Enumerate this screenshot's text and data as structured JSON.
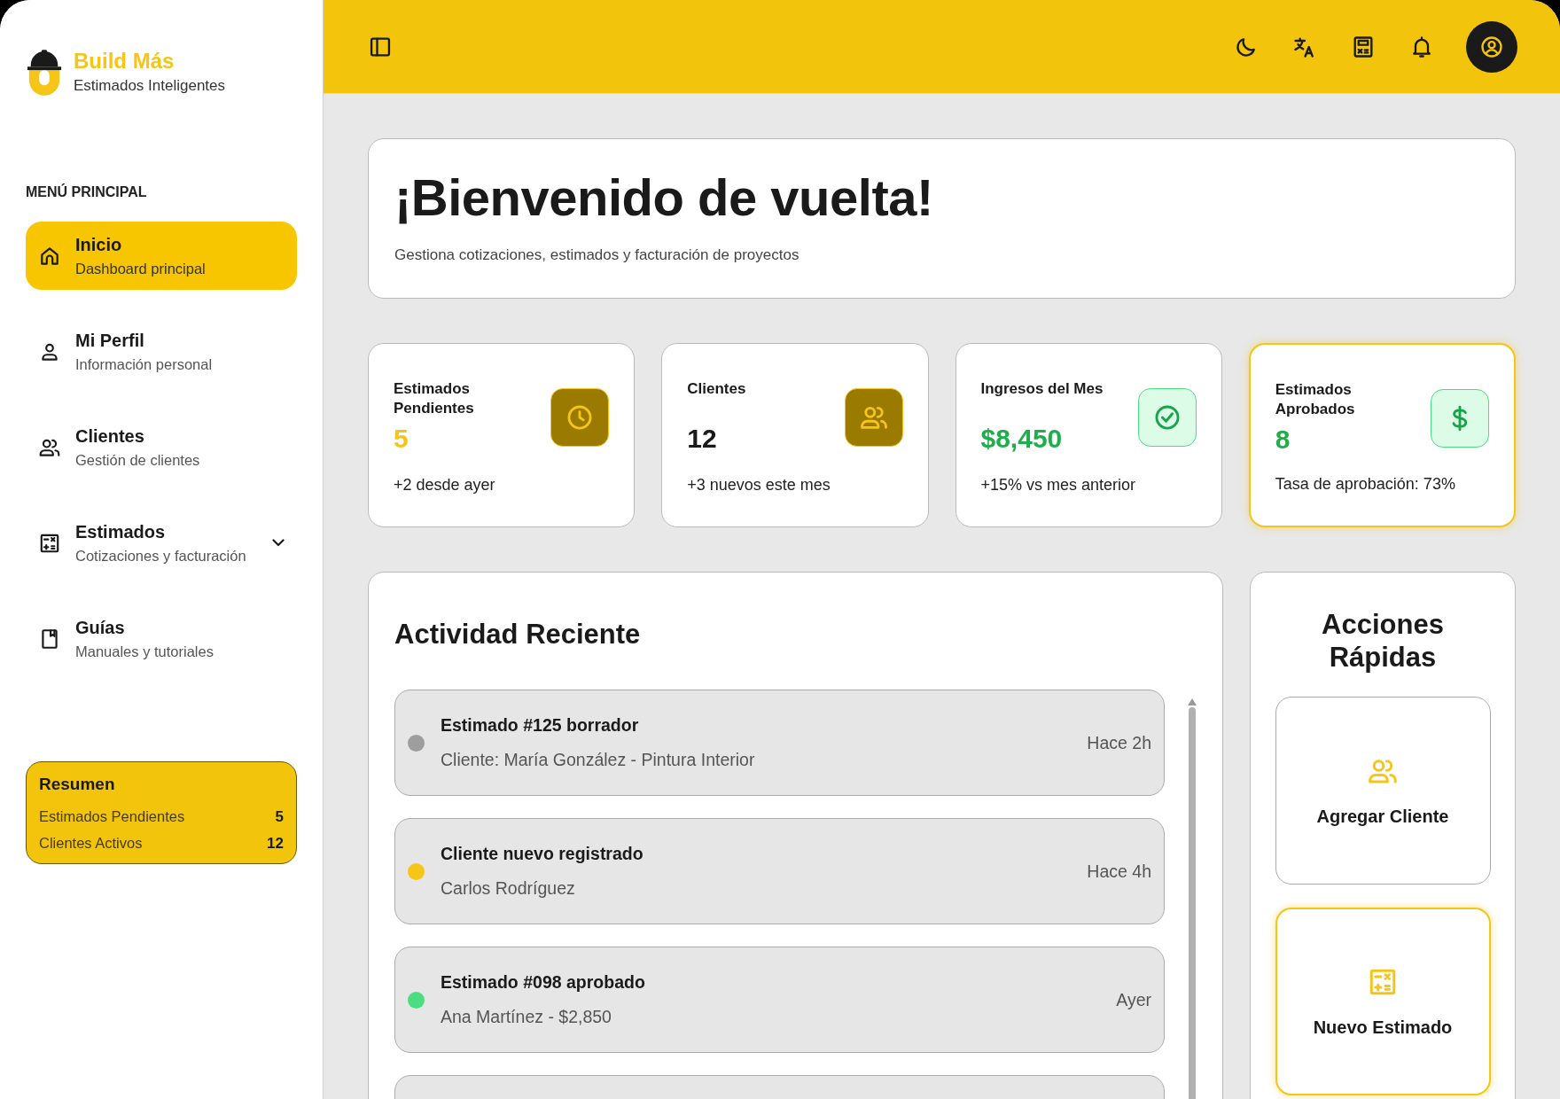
{
  "brand": {
    "name": "Build Más",
    "tagline": "Estimados Inteligentes"
  },
  "sidebar": {
    "section_title": "MENÚ PRINCIPAL",
    "items": [
      {
        "kind": "home",
        "label": "Inicio",
        "description": "Dashboard principal",
        "selected": true,
        "has_submenu": false
      },
      {
        "kind": "profile",
        "label": "Mi Perfil",
        "description": "Información personal",
        "selected": false,
        "has_submenu": false
      },
      {
        "kind": "clients",
        "label": "Clientes",
        "description": "Gestión de clientes",
        "selected": false,
        "has_submenu": false
      },
      {
        "kind": "estimates",
        "label": "Estimados",
        "description": "Cotizaciones y facturación",
        "selected": false,
        "has_submenu": true
      },
      {
        "kind": "guides",
        "label": "Guías",
        "description": "Manuales y tutoriales",
        "selected": false,
        "has_submenu": false
      }
    ],
    "summary": {
      "title": "Resumen",
      "rows": [
        {
          "label": "Estimados Pendientes",
          "value": "5"
        },
        {
          "label": "Clientes Activos",
          "value": "12"
        }
      ]
    }
  },
  "welcome": {
    "title": "¡Bienvenido de vuelta!",
    "subtitle": "Gestiona cotizaciones, estimados y facturación de proyectos"
  },
  "stats": [
    {
      "kind": "pending",
      "label": "Estimados Pendientes",
      "value": "5",
      "note": "+2 desde ayer",
      "highlighted": false
    },
    {
      "kind": "clients",
      "label": "Clientes",
      "value": "12",
      "note": "+3 nuevos este mes",
      "highlighted": false
    },
    {
      "kind": "income",
      "label": "Ingresos del Mes",
      "value": "$8,450",
      "note": "+15% vs mes anterior",
      "highlighted": false
    },
    {
      "kind": "approved",
      "label": "Estimados Aprobados",
      "value": "8",
      "note": "Tasa de aprobación: 73%",
      "highlighted": true
    }
  ],
  "activity": {
    "title": "Actividad Reciente",
    "items": [
      {
        "title": "Estimado #125 borrador",
        "detail": "Cliente: María González - Pintura Interior",
        "time": "Hace 2h",
        "color": "#9e9e9e"
      },
      {
        "title": "Cliente nuevo registrado",
        "detail": "Carlos Rodríguez",
        "time": "Hace 4h",
        "color": "#f5c518"
      },
      {
        "title": "Estimado #098 aprobado",
        "detail": "Ana Martínez - $2,850",
        "time": "Ayer",
        "color": "#4ade80"
      }
    ]
  },
  "quick_actions": {
    "title": "Acciones Rápidas",
    "items": [
      {
        "kind": "client",
        "label": "Agregar Cliente",
        "highlighted": false
      },
      {
        "kind": "estimate",
        "label": "Nuevo Estimado",
        "highlighted": true
      }
    ]
  }
}
